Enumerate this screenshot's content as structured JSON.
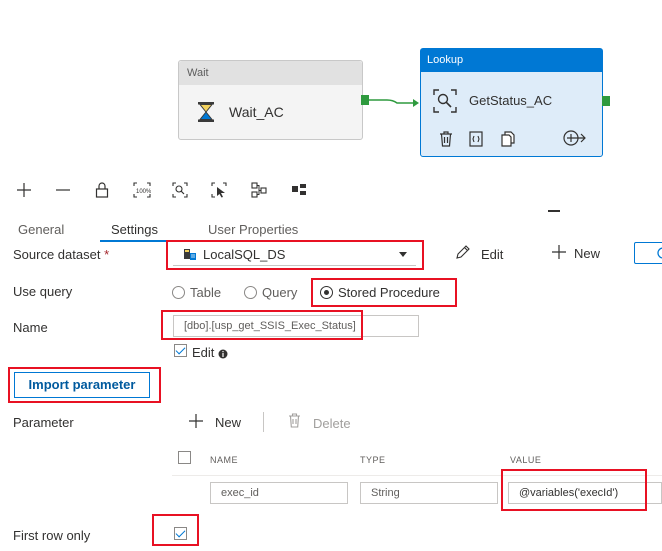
{
  "canvas": {
    "wait_node": {
      "header": "Wait",
      "name": "Wait_AC",
      "icon": "hourglass-icon"
    },
    "lookup_node": {
      "header": "Lookup",
      "name": "GetStatus_AC",
      "icon": "lookup-magnifier-icon",
      "actions": [
        "delete-icon",
        "code-icon",
        "copy-icon",
        "add-output-icon"
      ]
    }
  },
  "toolbar": {
    "icons": [
      "add-icon",
      "remove-icon",
      "lock-icon",
      "zoom-100-icon",
      "zoom-fit-icon",
      "select-icon",
      "auto-align-icon",
      "layout-icon"
    ]
  },
  "tabs": [
    {
      "label": "General",
      "active": false
    },
    {
      "label": "Settings",
      "active": true
    },
    {
      "label": "User Properties",
      "active": false
    }
  ],
  "settings": {
    "source_dataset": {
      "label": "Source dataset",
      "required_mark": "*",
      "value": "LocalSQL_DS",
      "edit_label": "Edit",
      "new_label": "New"
    },
    "use_query": {
      "label": "Use query",
      "options": [
        "Table",
        "Query",
        "Stored Procedure"
      ],
      "selected": "Stored Procedure"
    },
    "name": {
      "label": "Name",
      "value": "[dbo].[usp_get_SSIS_Exec_Status]",
      "edit_checkbox_label": "Edit",
      "edit_checked": true
    },
    "import_parameter_label": "Import parameter",
    "parameter": {
      "label": "Parameter",
      "new_label": "New",
      "delete_label": "Delete",
      "columns": [
        "NAME",
        "TYPE",
        "VALUE"
      ],
      "rows": [
        {
          "name": "exec_id",
          "type": "String",
          "value": "@variables('execId')"
        }
      ]
    },
    "first_row_only": {
      "label": "First row only",
      "checked": true
    }
  },
  "colors": {
    "accent": "#0078d4",
    "highlight_box": "#e81123",
    "port": "#2e9a3e"
  }
}
